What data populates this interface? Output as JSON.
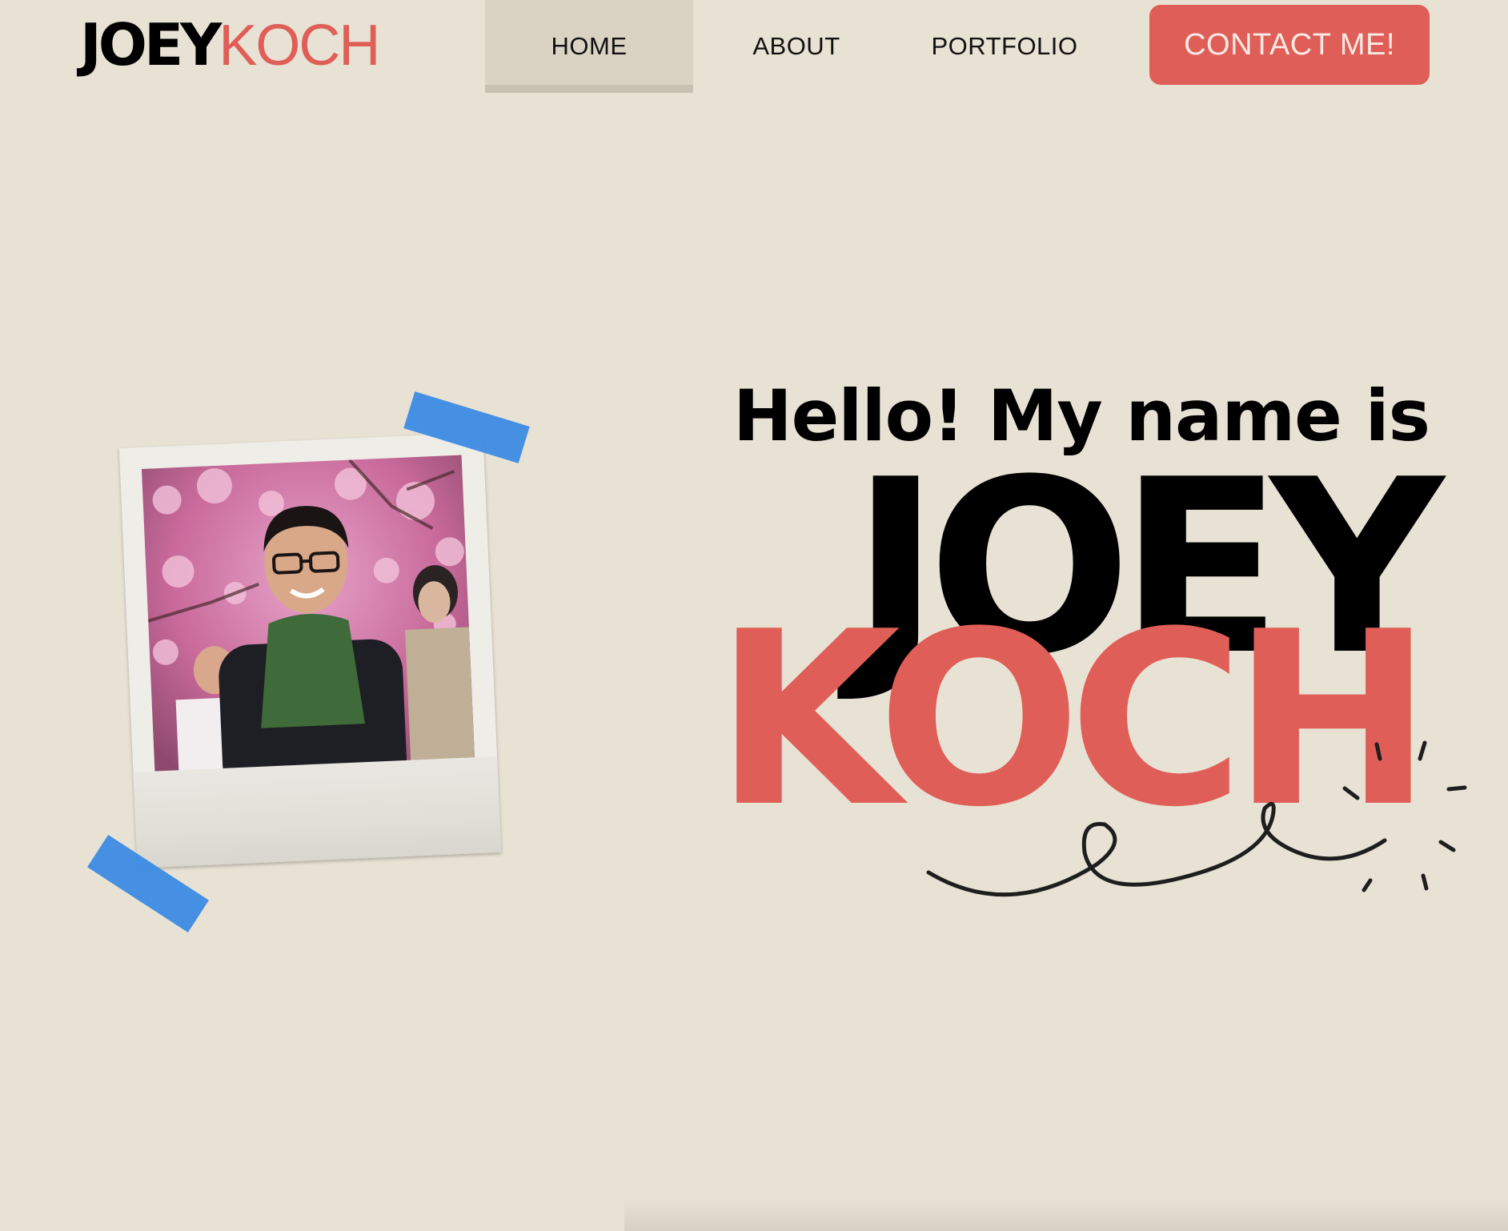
{
  "header": {
    "logo_first": "JOEY",
    "logo_last": "KOCH",
    "nav": {
      "home": "HOME",
      "about": "ABOUT",
      "portfolio": "PORTFOLIO"
    },
    "contact_label": "CONTACT ME!"
  },
  "hero": {
    "greeting": "Hello! My name is",
    "first_name": "JOEY",
    "last_name": "KOCH"
  },
  "colors": {
    "background": "#E8E2D4",
    "accent": "#DF5E58",
    "nav_active_bg": "#DAD3C4",
    "tape": "#3C8BE4"
  },
  "icons": {
    "photo": "portrait-photo",
    "tape": "tape-strip",
    "squiggle": "squiggle-doodle"
  }
}
